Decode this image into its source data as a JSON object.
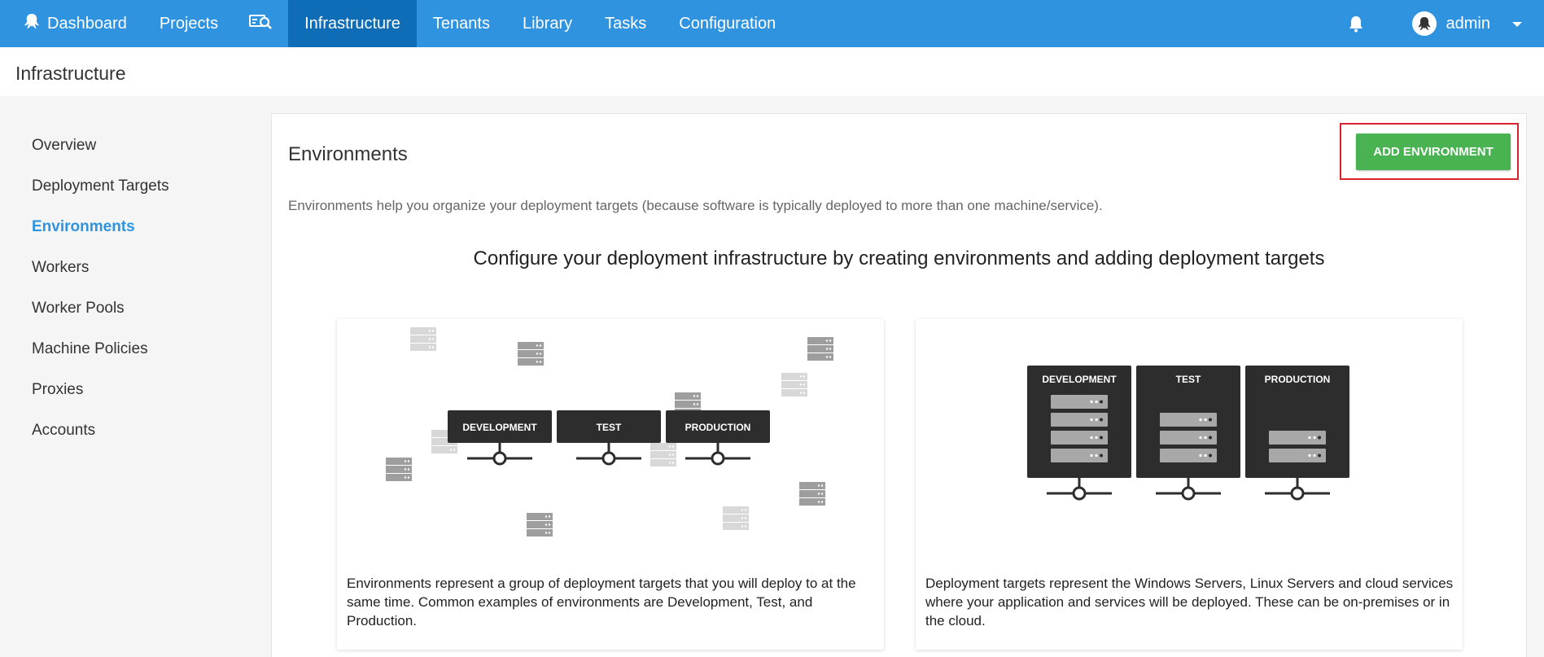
{
  "nav": {
    "items": [
      {
        "label": "Dashboard"
      },
      {
        "label": "Projects"
      },
      {
        "label": "Infrastructure"
      },
      {
        "label": "Tenants"
      },
      {
        "label": "Library"
      },
      {
        "label": "Tasks"
      },
      {
        "label": "Configuration"
      }
    ],
    "active_index": 2,
    "user": "admin",
    "accent_color": "#2f93e0",
    "active_color": "#0f6cb6"
  },
  "page": {
    "title": "Infrastructure"
  },
  "sidebar": {
    "items": [
      {
        "label": "Overview"
      },
      {
        "label": "Deployment Targets"
      },
      {
        "label": "Environments"
      },
      {
        "label": "Workers"
      },
      {
        "label": "Worker Pools"
      },
      {
        "label": "Machine Policies"
      },
      {
        "label": "Proxies"
      },
      {
        "label": "Accounts"
      }
    ],
    "active_index": 2
  },
  "main": {
    "title": "Environments",
    "add_button": "ADD ENVIRONMENT",
    "add_button_color": "#48b350",
    "description": "Environments help you organize your deployment targets (because software is typically deployed to more than one machine/service).",
    "heading": "Configure your deployment infrastructure by creating environments and adding deployment targets",
    "cards": [
      {
        "labels": [
          "DEVELOPMENT",
          "TEST",
          "PRODUCTION"
        ],
        "text": "Environments represent a group of deployment targets that you will deploy to at the same time. Common examples of environments are Development, Test, and Production."
      },
      {
        "labels": [
          "DEVELOPMENT",
          "TEST",
          "PRODUCTION"
        ],
        "text": "Deployment targets represent the Windows Servers, Linux Servers and cloud services where your application and services will be deployed. These can be on-premises or in the cloud."
      }
    ]
  }
}
